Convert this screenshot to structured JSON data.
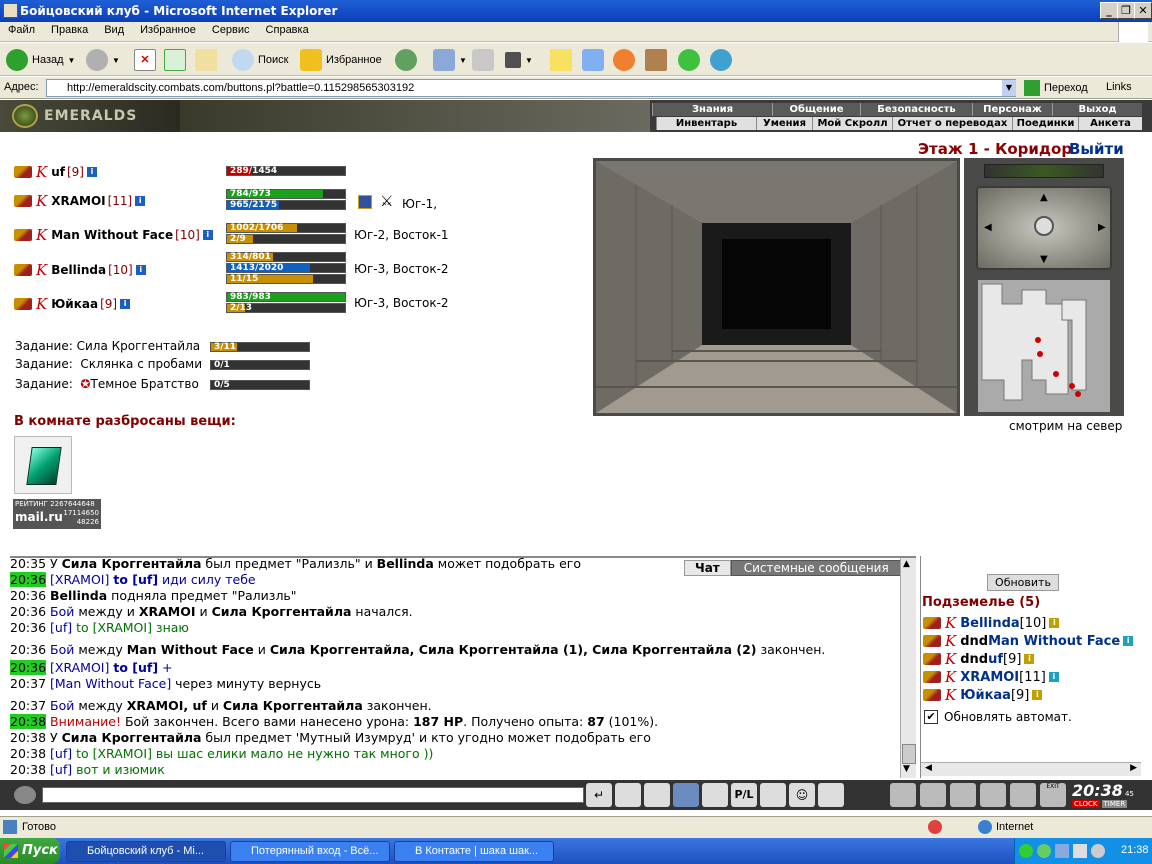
{
  "window": {
    "title": "Бойцовский клуб - Microsoft Internet Explorer"
  },
  "menu": [
    "Файл",
    "Правка",
    "Вид",
    "Избранное",
    "Сервис",
    "Справка"
  ],
  "toolbar": {
    "back": "Назад",
    "search": "Поиск",
    "favorites": "Избранное"
  },
  "address": {
    "label": "Адрес:",
    "url": "http://emeraldscity.combats.com/buttons.pl?battle=0.115298565303192",
    "go": "Переход",
    "links": "Links"
  },
  "game": {
    "logo": "EMERALDS",
    "nav_top": [
      "Знания",
      "Общение",
      "Безопасность",
      "Персонаж",
      "Выход"
    ],
    "nav_bottom": [
      "Инвентарь",
      "Умения",
      "Мой Скролл",
      "Отчет о переводах",
      "Поединки",
      "Анкета"
    ]
  },
  "location": {
    "title": "Этаж 1 - Коридор",
    "exit": "Выйти",
    "facing": "смотрим на север"
  },
  "party": [
    {
      "name": "uf",
      "level": "[9]",
      "bars": [
        "289/1454"
      ],
      "loc": ""
    },
    {
      "name": "XRAMOI",
      "level": "[11]",
      "bars": [
        "784/973",
        "965/2175"
      ],
      "loc": "Юг-1,"
    },
    {
      "name": "Man Without Face",
      "level": "[10]",
      "bars": [
        "1002/1706",
        "2/9"
      ],
      "loc": "Юг-2, Восток-1"
    },
    {
      "name": "Bellinda",
      "level": "[10]",
      "bars": [
        "314/801",
        "1413/2020",
        "11/15"
      ],
      "loc": "Юг-3, Восток-2"
    },
    {
      "name": "Юйкаа",
      "level": "[9]",
      "bars": [
        "983/983",
        "2/13"
      ],
      "loc": "Юг-3, Восток-2"
    }
  ],
  "tasks": [
    {
      "label": "Задание:",
      "name": "Сила Кроггентайла",
      "progress": "3/11"
    },
    {
      "label": "Задание:",
      "name": "Склянка с пробами",
      "progress": "0/1"
    },
    {
      "label": "Задание:",
      "name": "Темное Братство",
      "progress": "0/5"
    }
  ],
  "items_title": "В комнате разбросаны вещи:",
  "counter": {
    "label": "РЕЙТИНГ",
    "n1": "2267644648",
    "brand": "mail.ru",
    "n2": "17114650",
    "n3": "48226"
  },
  "chat": {
    "tab_chat": "Чат",
    "tab_sys": "Системные сообщения",
    "lines": [
      {
        "t": "20:35",
        "parts": [
          [
            "У ",
            ""
          ],
          [
            "Сила Кроггентайла",
            "b"
          ],
          [
            " был предмет \"Рализль\" и ",
            ""
          ],
          [
            "Bellinda",
            "b"
          ],
          [
            " может подобрать его",
            ""
          ]
        ]
      },
      {
        "t": "20:36",
        "hl": 1,
        "parts": [
          [
            "[XRAMOI] ",
            "blue"
          ],
          [
            "to [uf]",
            "blueb"
          ],
          [
            " иди силу тебе",
            "blue"
          ]
        ]
      },
      {
        "t": "20:36",
        "parts": [
          [
            "Bellinda",
            "b"
          ],
          [
            " подняла предмет \"Рализль\"",
            ""
          ]
        ]
      },
      {
        "t": "20:36",
        "parts": [
          [
            "Бой",
            "blue"
          ],
          [
            " между и ",
            ""
          ],
          [
            "XRAMOI",
            "b"
          ],
          [
            " и ",
            ""
          ],
          [
            "Сила Кроггентайла",
            "b"
          ],
          [
            " начался.",
            ""
          ]
        ]
      },
      {
        "t": "20:36",
        "parts": [
          [
            "[uf] ",
            "blue"
          ],
          [
            "to [XRAMOI] знаю",
            "grn"
          ]
        ]
      },
      {
        "t": "20:36",
        "parts": [
          [
            "Бой",
            "blue"
          ],
          [
            " между ",
            ""
          ],
          [
            "Man Without Face",
            "b"
          ],
          [
            "   и ",
            ""
          ],
          [
            "Сила Кроггентайла, Сила Кроггентайла (1), Сила Кроггентайла (2)",
            "b"
          ],
          [
            " закончен.",
            ""
          ]
        ]
      },
      {
        "t": "20:36",
        "hl": 1,
        "parts": [
          [
            "[XRAMOI] ",
            "blue"
          ],
          [
            "to [uf]",
            "blueb"
          ],
          [
            " +",
            "blue"
          ]
        ]
      },
      {
        "t": "20:37",
        "parts": [
          [
            "[Man Without Face]",
            "blue"
          ],
          [
            " через минуту вернусь",
            ""
          ]
        ]
      },
      {
        "t": "20:37",
        "parts": [
          [
            "Бой",
            "blue"
          ],
          [
            " между ",
            ""
          ],
          [
            "XRAMOI, uf",
            "b"
          ],
          [
            "   и ",
            ""
          ],
          [
            "Сила Кроггентайла",
            "b"
          ],
          [
            " закончен.",
            ""
          ]
        ]
      },
      {
        "t": "20:38",
        "hl": 1,
        "parts": [
          [
            "Внимание!",
            "red"
          ],
          [
            " Бой закончен. Всего вами нанесено урона: ",
            ""
          ],
          [
            "187 HP",
            "b"
          ],
          [
            ". Получено опыта: ",
            ""
          ],
          [
            "87",
            "b"
          ],
          [
            " (101%).",
            ""
          ]
        ]
      },
      {
        "t": "20:38",
        "parts": [
          [
            "У ",
            ""
          ],
          [
            "Сила Кроггентайла",
            "b"
          ],
          [
            " был предмет 'Мутный Изумруд' и кто угодно может подобрать его",
            ""
          ]
        ]
      },
      {
        "t": "20:38",
        "parts": [
          [
            "[uf] ",
            "blue"
          ],
          [
            "to [XRAMOI] вы шас елики мало не нужно так много ))",
            "grn"
          ]
        ]
      },
      {
        "t": "20:38",
        "parts": [
          [
            "[uf] ",
            "blue"
          ],
          [
            "вот и изюмик",
            "grn"
          ]
        ]
      }
    ]
  },
  "online": {
    "refresh": "Обновить",
    "title": "Подземелье (5)",
    "list": [
      {
        "pre": "",
        "name": "Bellinda",
        "lvl": "[10]"
      },
      {
        "pre": "dnd ",
        "name": "Man Without Face",
        "lvl": ""
      },
      {
        "pre": "dnd ",
        "name": "uf",
        "lvl": "[9]"
      },
      {
        "pre": "",
        "name": "XRAMOI",
        "lvl": "[11]"
      },
      {
        "pre": "",
        "name": "Юйкаа",
        "lvl": "[9]"
      }
    ],
    "auto": "Обновлять автомат."
  },
  "clock": {
    "time": "20:38",
    "sec": "45",
    "a": "CLOCK",
    "b": "TIMER",
    "exit": "EXIT"
  },
  "status": {
    "ready": "Готово",
    "zone": "Internet"
  },
  "taskbar": {
    "start": "Пуск",
    "tasks": [
      "Бойцовский клуб - Mi...",
      "Потерянный вход - Всё...",
      "В Контакте | шака шак..."
    ],
    "time": "21:38"
  }
}
